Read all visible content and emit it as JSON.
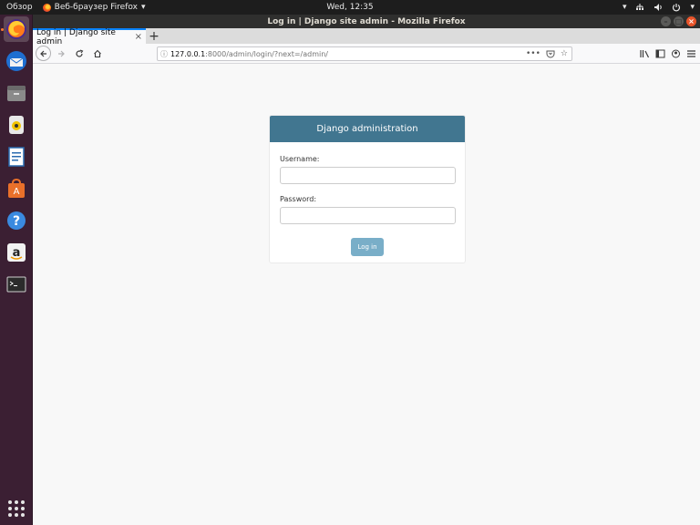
{
  "topbar": {
    "activities": "Обзор",
    "app_menu": "Веб-браузер Firefox",
    "clock": "Wed, 12:35"
  },
  "window": {
    "title": "Log in | Django site admin - Mozilla Firefox"
  },
  "tab": {
    "title": "Log in | Django site admin",
    "close": "×",
    "new_tab": "+"
  },
  "urlbar": {
    "host": "127.0.0.1",
    "path": ":8000/admin/login/?next=/admin/"
  },
  "login": {
    "header": "Django administration",
    "username_label": "Username:",
    "username_value": "",
    "password_label": "Password:",
    "password_value": "",
    "submit": "Log in"
  },
  "icons": {
    "dock": [
      "firefox-icon",
      "thunderbird-icon",
      "files-icon",
      "rhythmbox-icon",
      "writer-icon",
      "software-icon",
      "help-icon",
      "amazon-icon",
      "terminal-icon"
    ]
  }
}
